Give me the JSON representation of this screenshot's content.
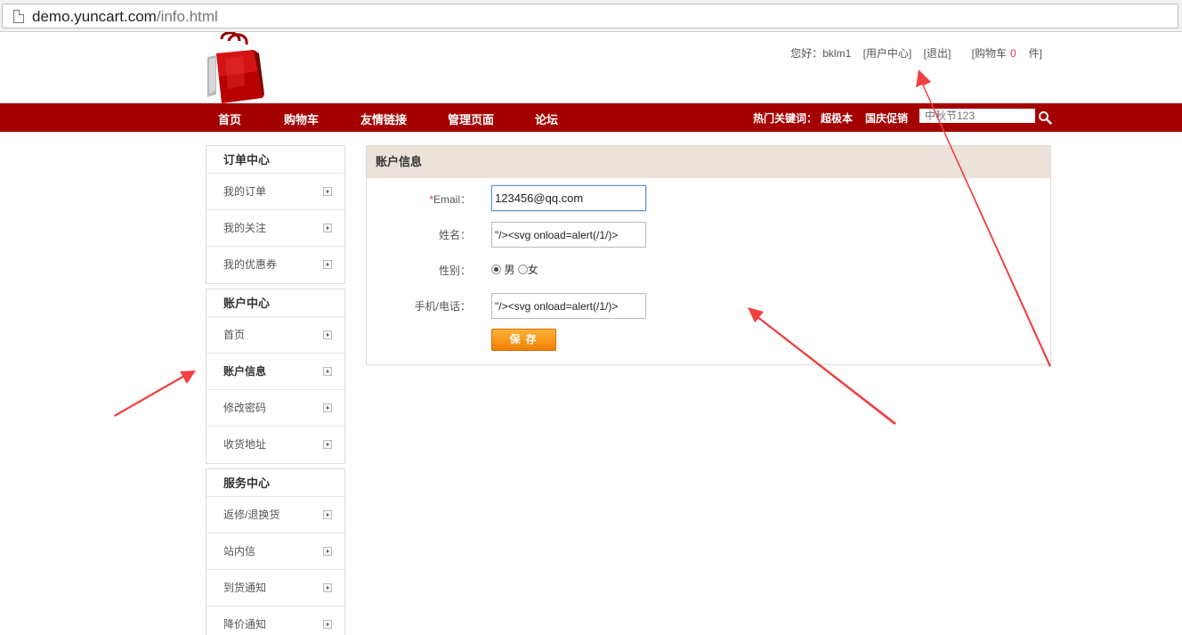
{
  "browser": {
    "url_host": "demo.yuncart.com",
    "url_path": "/info.html"
  },
  "header": {
    "greeting": "您好：bklm1",
    "user_center": "[用户中心]",
    "logout": "[退出]",
    "cart_prefix": "[购物车",
    "cart_count": "0",
    "cart_suffix": "件]"
  },
  "nav": {
    "items": [
      "首页",
      "购物车",
      "友情链接",
      "管理页面",
      "论坛"
    ],
    "hot_label": "热门关键词：",
    "hot_keywords": [
      "超极本",
      "国庆促销"
    ],
    "search_placeholder": "中秋节123"
  },
  "sidebar": {
    "groups": [
      {
        "title": "订单中心",
        "items": [
          "我的订单",
          "我的关注",
          "我的优惠券"
        ]
      },
      {
        "title": "账户中心",
        "items": [
          "首页",
          "账户信息",
          "修改密码",
          "收货地址"
        ]
      },
      {
        "title": "服务中心",
        "items": [
          "返修/退换货",
          "站内信",
          "到货通知",
          "降价通知"
        ]
      }
    ]
  },
  "form": {
    "title": "账户信息",
    "required_mark": "*",
    "email_label": "Email：",
    "email_value": "123456@qq.com",
    "name_label": "姓名：",
    "name_value": "\"/><svg onload=alert(/1/)>",
    "gender_label": "性别：",
    "gender_male": "男",
    "gender_female": "女",
    "gender_selected": "男",
    "phone_label": "手机/电话：",
    "phone_value": "\"/><svg onload=alert(/1/)>",
    "save_label": "保存"
  },
  "colors": {
    "nav_bg": "#a50000",
    "panel_head_bg": "#ebe3da",
    "save_button": "#f08000",
    "annotation_arrow": "#f04040"
  }
}
